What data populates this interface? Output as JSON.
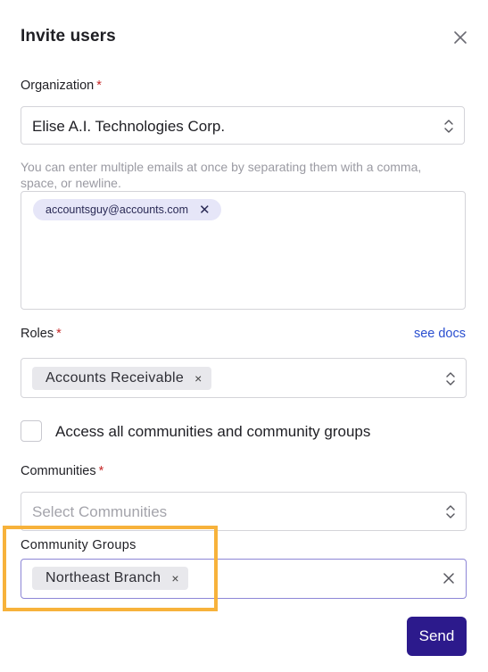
{
  "modal": {
    "title": "Invite users",
    "close_icon": "close-icon"
  },
  "organization": {
    "label": "Organization",
    "required_mark": "*",
    "value": "Elise A.I. Technologies Corp."
  },
  "emails": {
    "hint": "You can enter multiple emails at once by separating them with a comma, space, or newline.",
    "chips": [
      "accountsguy@accounts.com"
    ],
    "remove_symbol": "✕"
  },
  "roles": {
    "label": "Roles",
    "required_mark": "*",
    "see_docs": "see docs",
    "chips": [
      "Accounts Receivable"
    ],
    "remove_symbol": "×"
  },
  "access_all": {
    "label": "Access all communities and community groups",
    "checked": false
  },
  "communities": {
    "label": "Communities",
    "required_mark": "*",
    "placeholder": "Select Communities"
  },
  "community_groups": {
    "label": "Community Groups",
    "chips": [
      "Northeast Branch"
    ],
    "remove_symbol": "×",
    "highlight_color": "#f7b23b"
  },
  "actions": {
    "send_label": "Send",
    "send_color": "#2c1a8c"
  },
  "colors": {
    "required": "#c62828",
    "link": "#2a4fd0"
  }
}
